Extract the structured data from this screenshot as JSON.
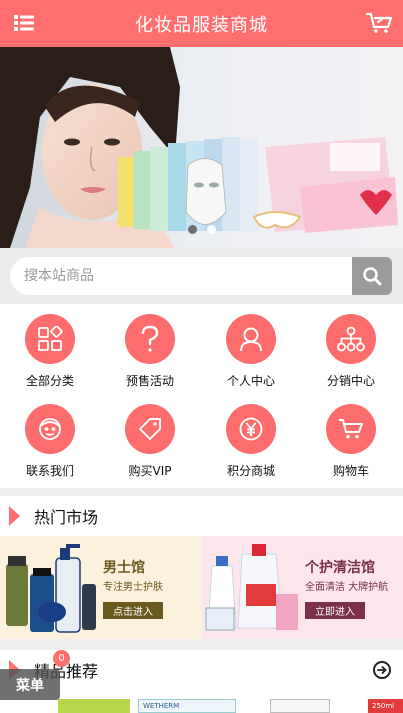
{
  "header": {
    "title": "化妆品服装商城",
    "left_icon": "list-menu-icon",
    "right_icon": "shopping-cart-icon"
  },
  "banner": {
    "slides": 2,
    "active_slide": 1
  },
  "search": {
    "placeholder": "搜本站商品",
    "icon": "search-icon"
  },
  "nav_grid": [
    {
      "label": "全部分类",
      "icon": "category-grid-icon"
    },
    {
      "label": "预售活动",
      "icon": "question-mark-icon"
    },
    {
      "label": "个人中心",
      "icon": "person-icon"
    },
    {
      "label": "分销中心",
      "icon": "network-share-icon"
    },
    {
      "label": "联系我们",
      "icon": "face-contact-icon"
    },
    {
      "label": "购买VIP",
      "icon": "tag-icon"
    },
    {
      "label": "积分商城",
      "icon": "yen-coin-icon"
    },
    {
      "label": "购物车",
      "icon": "cart-icon"
    }
  ],
  "hot_market": {
    "title": "热门市场",
    "promos": [
      {
        "title": "男士馆",
        "subtitle": "专注男士护肤",
        "button": "点击进入",
        "color": "#6b5a1f"
      },
      {
        "title": "个护清洁馆",
        "subtitle": "全面清洁 大牌护航",
        "button": "立即进入",
        "color": "#7a2f4a"
      }
    ]
  },
  "featured": {
    "title": "精品推荐",
    "thumb_texts": [
      "WETHERM",
      "250ml"
    ]
  },
  "floating_menu": {
    "label": "菜单",
    "badge": "0"
  },
  "colors": {
    "accent": "#ff6f6f",
    "icon_circle": "#fd6d6d"
  }
}
